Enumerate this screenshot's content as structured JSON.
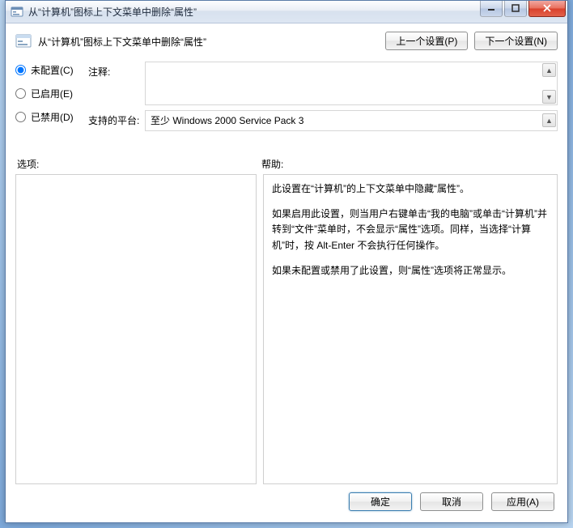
{
  "window": {
    "title": "从“计算机”图标上下文菜单中删除“属性”"
  },
  "header": {
    "title": "从“计算机”图标上下文菜单中删除“属性”"
  },
  "nav": {
    "prev": "上一个设置(P)",
    "next": "下一个设置(N)"
  },
  "radios": {
    "not_configured": "未配置(C)",
    "enabled": "已启用(E)",
    "disabled": "已禁用(D)",
    "selected": "not_configured"
  },
  "fields": {
    "comment_label": "注释:",
    "comment_value": "",
    "supported_label": "支持的平台:",
    "supported_value": "至少 Windows 2000 Service Pack 3"
  },
  "panels": {
    "options_label": "选项:",
    "help_label": "帮助:",
    "help_text": [
      "此设置在“计算机”的上下文菜单中隐藏“属性”。",
      "如果启用此设置，则当用户右键单击“我的电脑”或单击“计算机”并转到“文件”菜单时，不会显示“属性”选项。同样，当选择“计算机”时，按 Alt-Enter 不会执行任何操作。",
      "如果未配置或禁用了此设置，则“属性”选项将正常显示。"
    ]
  },
  "footer": {
    "ok": "确定",
    "cancel": "取消",
    "apply": "应用(A)"
  }
}
